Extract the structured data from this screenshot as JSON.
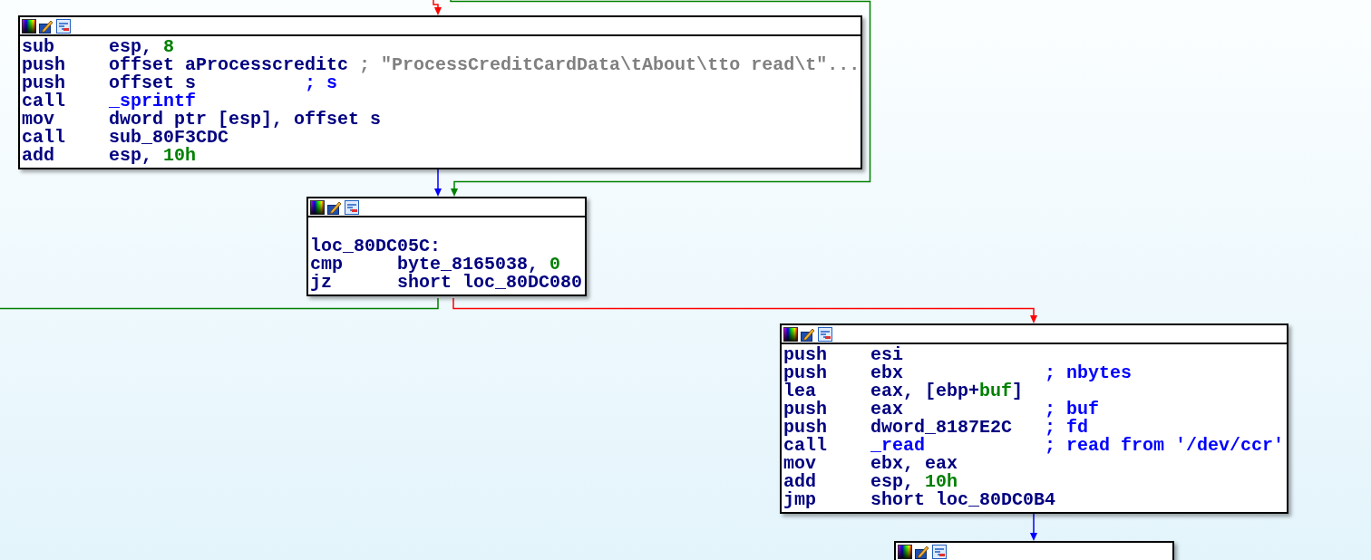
{
  "nodes": [
    {
      "kind": "code",
      "lines": [
        {
          "mnemonic": "sub",
          "operand": [
            {
              "text": "esp, ",
              "kind": "plain"
            },
            {
              "text": "8",
              "kind": "number"
            }
          ]
        },
        {
          "mnemonic": "push",
          "operand": [
            {
              "text": "offset aProcesscreditc",
              "kind": "plain"
            }
          ],
          "comment": [
            {
              "text": "; \"ProcessCreditCardData\\tAbout\\tto read\\t\"...",
              "kind": "string"
            }
          ]
        },
        {
          "mnemonic": "push",
          "operand": [
            {
              "text": "offset s",
              "kind": "plain"
            }
          ],
          "comment": [
            {
              "text": "; s",
              "kind": "name"
            }
          ]
        },
        {
          "mnemonic": "call",
          "operand": [
            {
              "text": "_sprintf",
              "kind": "name"
            }
          ]
        },
        {
          "mnemonic": "mov",
          "operand": [
            {
              "text": "dword ptr [esp], offset s",
              "kind": "plain"
            }
          ]
        },
        {
          "mnemonic": "call",
          "operand": [
            {
              "text": "sub_80F3CDC",
              "kind": "plain"
            }
          ]
        },
        {
          "mnemonic": "add",
          "operand": [
            {
              "text": "esp, ",
              "kind": "plain"
            },
            {
              "text": "10h",
              "kind": "number"
            }
          ]
        }
      ]
    },
    {
      "kind": "code",
      "label": "loc_80DC05C:",
      "lines": [
        {
          "mnemonic": "cmp",
          "operand": [
            {
              "text": "byte_8165038, ",
              "kind": "plain"
            },
            {
              "text": "0",
              "kind": "number"
            }
          ]
        },
        {
          "mnemonic": "jz",
          "operand": [
            {
              "text": "short loc_80DC080",
              "kind": "plain"
            }
          ]
        }
      ]
    },
    {
      "kind": "code",
      "lines": [
        {
          "mnemonic": "push",
          "operand": [
            {
              "text": "esi",
              "kind": "plain"
            }
          ]
        },
        {
          "mnemonic": "push",
          "operand": [
            {
              "text": "ebx",
              "kind": "plain"
            }
          ],
          "comment": [
            {
              "text": "; nbytes",
              "kind": "name"
            }
          ]
        },
        {
          "mnemonic": "lea",
          "operand": [
            {
              "text": "eax, [ebp+",
              "kind": "plain"
            },
            {
              "text": "buf",
              "kind": "number"
            },
            {
              "text": "]",
              "kind": "plain"
            }
          ]
        },
        {
          "mnemonic": "push",
          "operand": [
            {
              "text": "eax",
              "kind": "plain"
            }
          ],
          "comment": [
            {
              "text": "; buf",
              "kind": "name"
            }
          ]
        },
        {
          "mnemonic": "push",
          "operand": [
            {
              "text": "dword_8187E2C",
              "kind": "plain"
            }
          ],
          "comment": [
            {
              "text": "; fd",
              "kind": "name"
            }
          ]
        },
        {
          "mnemonic": "call",
          "operand": [
            {
              "text": "_read",
              "kind": "name"
            }
          ],
          "comment": [
            {
              "text": "; read from '/dev/ccr'",
              "kind": "name"
            }
          ]
        },
        {
          "mnemonic": "mov",
          "operand": [
            {
              "text": "ebx, eax",
              "kind": "plain"
            }
          ]
        },
        {
          "mnemonic": "add",
          "operand": [
            {
              "text": "esp, ",
              "kind": "plain"
            },
            {
              "text": "10h",
              "kind": "number"
            }
          ]
        },
        {
          "mnemonic": "jmp",
          "operand": [
            {
              "text": "short loc_80DC0B4",
              "kind": "plain"
            }
          ]
        }
      ]
    },
    {
      "kind": "header_only"
    }
  ]
}
